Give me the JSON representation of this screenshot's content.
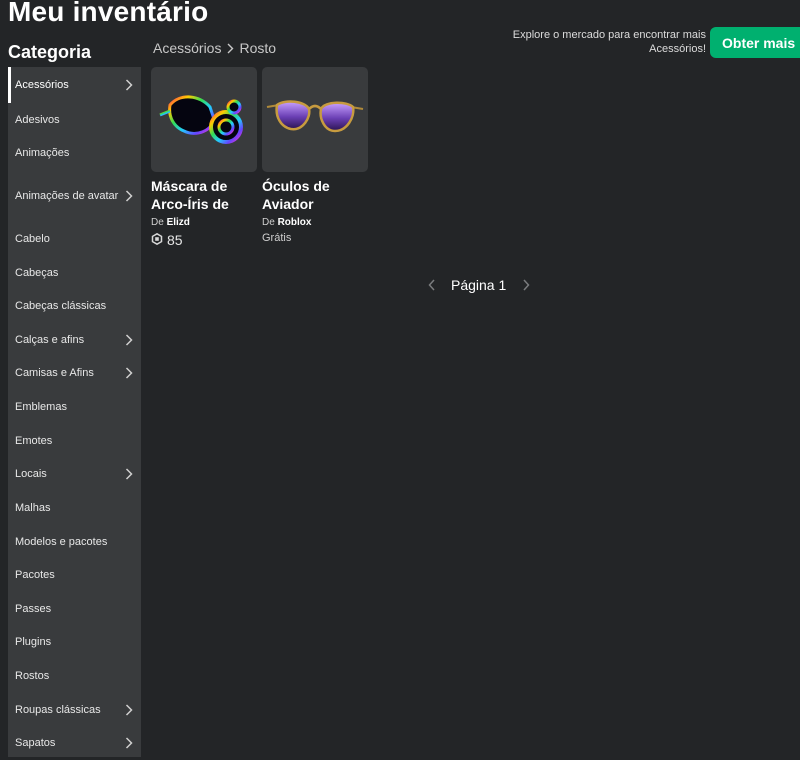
{
  "header": {
    "title": "Meu inventário"
  },
  "sidebar": {
    "heading": "Categoria",
    "items": [
      {
        "label": "Acessórios",
        "chevron": true,
        "active": true
      },
      {
        "label": "Adesivos",
        "chevron": false
      },
      {
        "label": "Animações",
        "chevron": false
      },
      {
        "label": "Animações de avatar",
        "chevron": true
      },
      {
        "label": "Cabelo",
        "chevron": false
      },
      {
        "label": "Cabeças",
        "chevron": false
      },
      {
        "label": "Cabeças clássicas",
        "chevron": false
      },
      {
        "label": "Calças e afins",
        "chevron": true
      },
      {
        "label": "Camisas e Afins",
        "chevron": true
      },
      {
        "label": "Emblemas",
        "chevron": false
      },
      {
        "label": "Emotes",
        "chevron": false
      },
      {
        "label": "Locais",
        "chevron": true
      },
      {
        "label": "Malhas",
        "chevron": false
      },
      {
        "label": "Modelos e pacotes",
        "chevron": false
      },
      {
        "label": "Pacotes",
        "chevron": false
      },
      {
        "label": "Passes",
        "chevron": false
      },
      {
        "label": "Plugins",
        "chevron": false
      },
      {
        "label": "Rostos",
        "chevron": false
      },
      {
        "label": "Roupas clássicas",
        "chevron": true
      },
      {
        "label": "Sapatos",
        "chevron": true
      }
    ]
  },
  "breadcrumb": {
    "parent": "Acessórios",
    "current": "Rosto"
  },
  "promo": {
    "text": "Explore o mercado para encontrar mais Acessórios!",
    "button_label": "Obter mais"
  },
  "items": [
    {
      "name": "Máscara de Arco-Íris de",
      "creator_prefix": "De",
      "creator": "Elizd",
      "price": "85",
      "icon": "robux-icon"
    },
    {
      "name": "Óculos de Aviador",
      "creator_prefix": "De",
      "creator": "Roblox",
      "price_text": "Grátis"
    }
  ],
  "pagination": {
    "label": "Página 1"
  },
  "colors": {
    "background": "#232527",
    "panel": "#393b3d",
    "accent": "#00b06f"
  }
}
